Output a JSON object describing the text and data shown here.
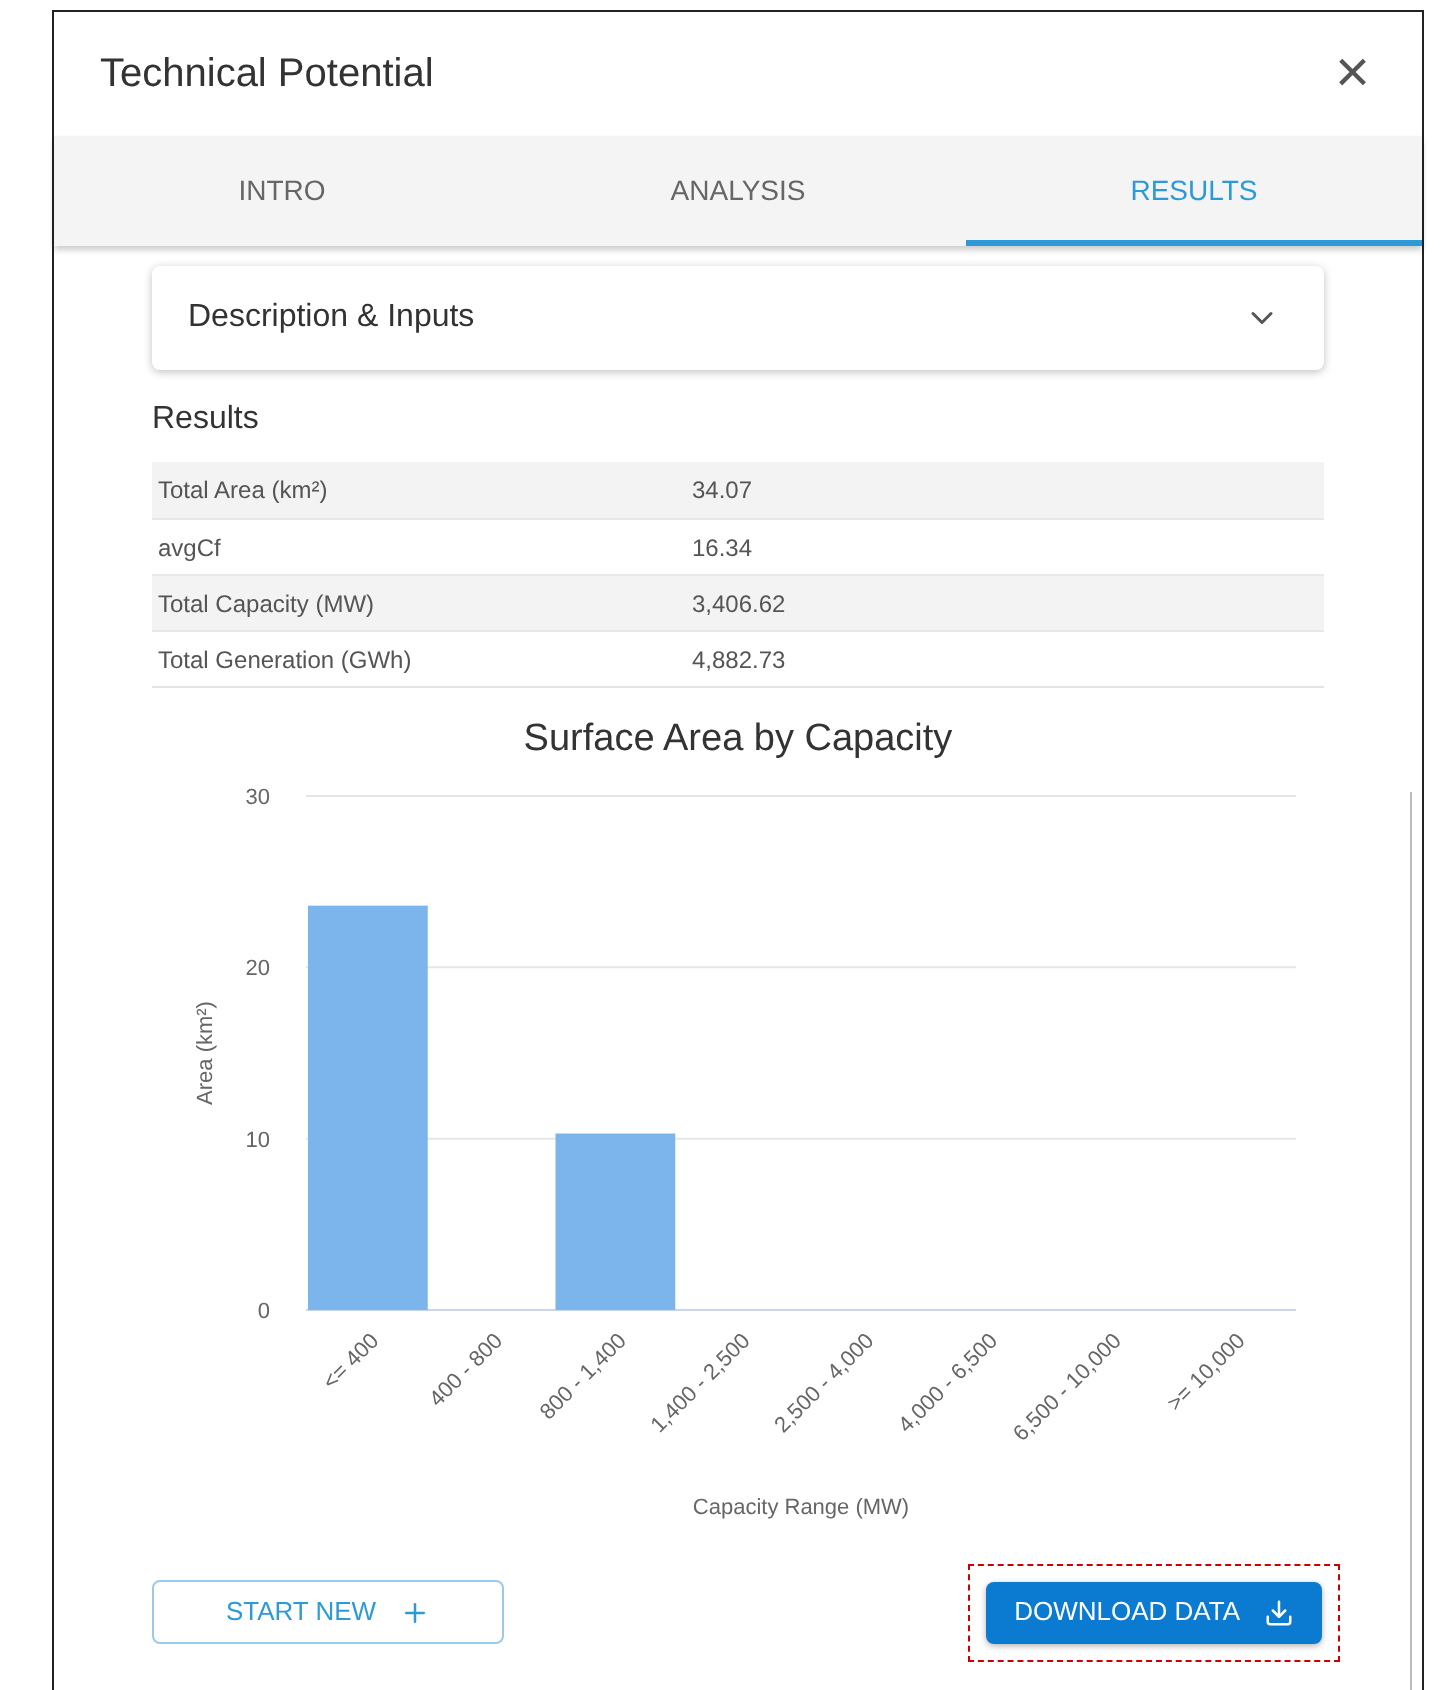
{
  "dialog": {
    "title": "Technical Potential",
    "close": "×"
  },
  "tabs": [
    {
      "label": "INTRO",
      "selected": false
    },
    {
      "label": "ANALYSIS",
      "selected": false
    },
    {
      "label": "RESULTS",
      "selected": true
    }
  ],
  "accordion": {
    "title": "Description & Inputs",
    "expanded": false
  },
  "results": {
    "heading": "Results",
    "rows": [
      {
        "label": "Total Area (km²)",
        "value": "34.07"
      },
      {
        "label": "avgCf",
        "value": "16.34"
      },
      {
        "label": "Total Capacity (MW)",
        "value": "3,406.62"
      },
      {
        "label": "Total Generation (GWh)",
        "value": "4,882.73"
      }
    ]
  },
  "chart": {
    "chart_data": {
      "type": "bar",
      "title": "Surface Area by Capacity",
      "xlabel": "Capacity Range (MW)",
      "ylabel": "Area (km²)",
      "categories": [
        "<= 400",
        "400 - 800",
        "800 - 1,400",
        "1,400 - 2,500",
        "2,500 - 4,000",
        "4,000 - 6,500",
        "6,500 - 10,000",
        ">= 10,000"
      ],
      "series": [
        {
          "color": "#7cb5ec",
          "values": [
            23.6,
            0,
            10.3,
            0,
            0,
            0,
            0,
            0
          ]
        }
      ],
      "ylim": [
        0,
        30
      ],
      "yticks": [
        0,
        10,
        20,
        30
      ]
    }
  },
  "buttons": [
    {
      "label": "START NEW",
      "kind": "outline",
      "highlighted": false
    },
    {
      "label": "DOWNLOAD DATA",
      "kind": "solid",
      "highlighted": true
    }
  ]
}
